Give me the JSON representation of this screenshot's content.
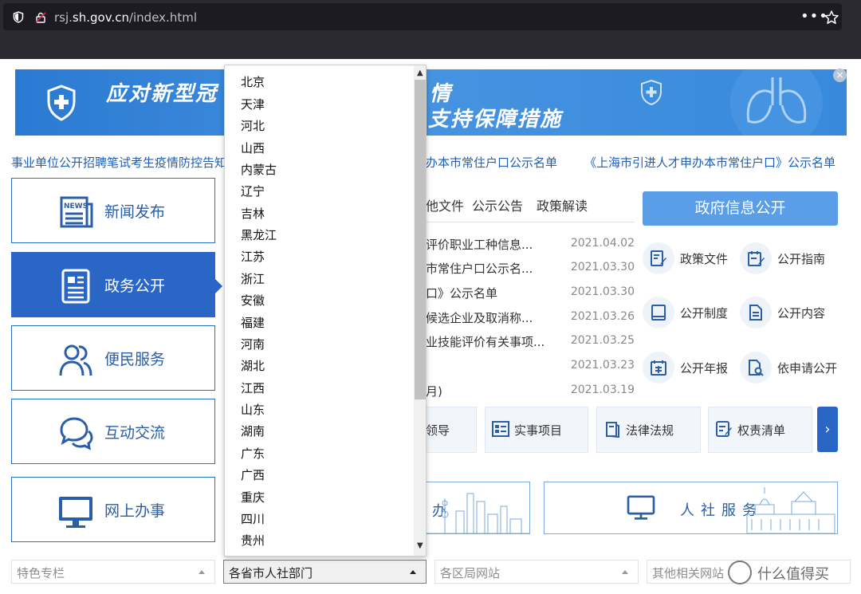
{
  "browser": {
    "url_prefix": "rsj.",
    "url_domain": "sh.gov.cn",
    "url_path": "/index.html",
    "menu_dots": "•••"
  },
  "banner": {
    "text_left": "应对新型冠",
    "text_right_top": "情",
    "text_right_bottom": "支持保障措施",
    "close": "×"
  },
  "marquee": {
    "item1": "事业单位公开招聘笔试考生疫情防控告知",
    "item2": "办本市常住户口公示名单",
    "item3": "《上海市引进人才申办本市常住户口》公示名单"
  },
  "nav": {
    "items": [
      {
        "label": "新闻发布"
      },
      {
        "label": "政务公开"
      },
      {
        "label": "便民服务"
      },
      {
        "label": "互动交流"
      },
      {
        "label": "网上办事"
      }
    ]
  },
  "tabs": {
    "t1": "他文件",
    "t2": "公示公告",
    "t3": "政策解读"
  },
  "news": [
    {
      "title": "评价职业工种信息...",
      "date": "2021.04.02"
    },
    {
      "title": "市常住户口公示名...",
      "date": "2021.03.30"
    },
    {
      "title": "口》公示名单",
      "date": "2021.03.30"
    },
    {
      "title": "候选企业及取消称...",
      "date": "2021.03.26"
    },
    {
      "title": "业技能评价有关事项...",
      "date": "2021.03.25"
    },
    {
      "title": "",
      "date": "2021.03.23"
    },
    {
      "title": "月)",
      "date": "2021.03.19"
    }
  ],
  "quick": {
    "q1": "领导",
    "q2": "实事项目",
    "q3": "法律法规",
    "q4": "权责清单",
    "next": "›"
  },
  "gov": {
    "button": "政府信息公开",
    "items": [
      "政策文件",
      "公开指南",
      "公开制度",
      "公开内容",
      "公开年报",
      "依申请公开"
    ]
  },
  "strips": {
    "left_text": "办",
    "right_text": "人社服务"
  },
  "selects": {
    "s1": "特色专栏",
    "s2": "各省市人社部门",
    "s3": "各区局网站",
    "s4": "其他相关网站"
  },
  "dropdown": {
    "items": [
      "北京",
      "天津",
      "河北",
      "山西",
      "内蒙古",
      "辽宁",
      "吉林",
      "黑龙江",
      "江苏",
      "浙江",
      "安徽",
      "福建",
      "河南",
      "湖北",
      "江西",
      "山东",
      "湖南",
      "广东",
      "广西",
      "重庆",
      "四川",
      "贵州"
    ]
  },
  "watermark": "什么值得买"
}
